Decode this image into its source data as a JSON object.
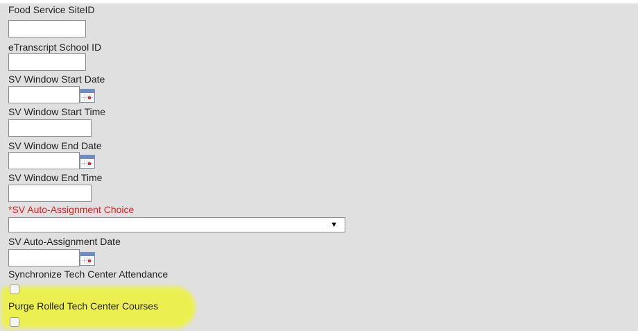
{
  "fields": {
    "food_service_site_id": {
      "label": "Food Service SiteID",
      "value": ""
    },
    "etranscript_school_id": {
      "label": "eTranscript School ID",
      "value": ""
    },
    "sv_window_start_date": {
      "label": "SV Window Start Date",
      "value": ""
    },
    "sv_window_start_time": {
      "label": "SV Window Start Time",
      "value": ""
    },
    "sv_window_end_date": {
      "label": "SV Window End Date",
      "value": ""
    },
    "sv_window_end_time": {
      "label": "SV Window End Time",
      "value": ""
    },
    "sv_auto_assignment_choice": {
      "label": "*SV Auto-Assignment Choice",
      "selected": "",
      "arrow": "▼"
    },
    "sv_auto_assignment_date": {
      "label": "SV Auto-Assignment Date",
      "value": ""
    },
    "synchronize_tech_center_attendance": {
      "label": "Synchronize Tech Center Attendance",
      "checked": false
    },
    "purge_rolled_tech_center_courses": {
      "label": "Purge Rolled Tech Center Courses",
      "checked": false
    }
  },
  "colors": {
    "background": "#e0e0e0",
    "required_label": "#e01e1e",
    "highlight": "#eef528"
  },
  "icons": {
    "calendar": "calendar-icon",
    "dropdown": "chevron-down-icon"
  }
}
